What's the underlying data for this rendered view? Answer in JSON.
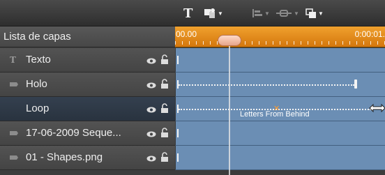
{
  "toolbar": {
    "tools": [
      {
        "name": "text-tool",
        "icon": "T",
        "dropdown": false
      },
      {
        "name": "shapes-tool",
        "icon": "shapes-icon",
        "dropdown": true
      },
      {
        "name": "align-tool",
        "icon": "align-icon",
        "dropdown": true,
        "disabled": true
      },
      {
        "name": "group-tool",
        "icon": "group-icon",
        "dropdown": true,
        "disabled": true
      },
      {
        "name": "arrange-tool",
        "icon": "arrange-icon",
        "dropdown": true
      }
    ]
  },
  "layer_panel": {
    "title": "Lista de capas"
  },
  "timeline": {
    "start_time": "00.00",
    "end_time": "0:00:01."
  },
  "layers": [
    {
      "name": "Texto",
      "icon": "text-layer-icon",
      "selected": false
    },
    {
      "name": "Holo",
      "icon": "shape-layer-icon",
      "selected": false
    },
    {
      "name": "Loop",
      "icon": "",
      "selected": true
    },
    {
      "name": "17-06-2009 Seque...",
      "icon": "shape-layer-icon",
      "selected": false
    },
    {
      "name": "01 - Shapes.png",
      "icon": "shape-layer-icon",
      "selected": false
    }
  ],
  "tracks": [
    {
      "layer": "Texto",
      "effect_label": ""
    },
    {
      "layer": "Holo",
      "effect_label": ""
    },
    {
      "layer": "Loop",
      "effect_label": "Letters From Behind"
    },
    {
      "layer": "17-06-2009 Seque...",
      "effect_label": ""
    },
    {
      "layer": "01 - Shapes.png",
      "effect_label": ""
    }
  ],
  "colors": {
    "ruler": "#e58a17",
    "track": "#6b8eb4",
    "selected_row": "#2f3a48",
    "keyframe_marker": "#ff9c2c"
  }
}
